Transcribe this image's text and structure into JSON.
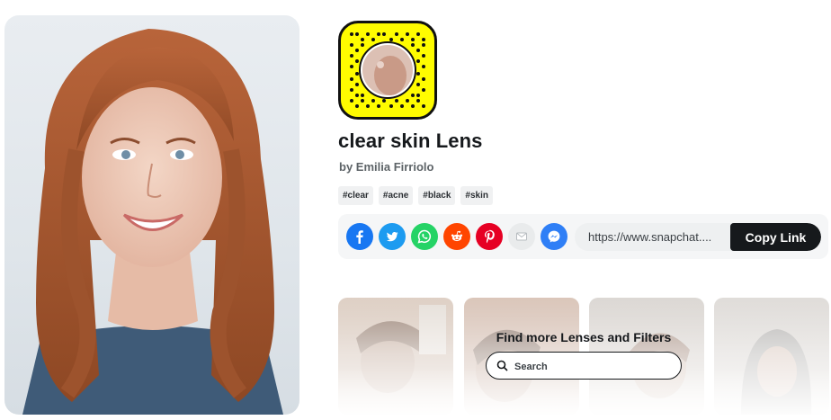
{
  "lens": {
    "title": "clear skin Lens",
    "author": "by Emilia Firriolo",
    "tags": [
      "#clear",
      "#acne",
      "#black",
      "#skin"
    ]
  },
  "snapcode": {
    "accent_color": "#fffc00"
  },
  "share": {
    "buttons": [
      {
        "name": "facebook-icon",
        "color": "#1877f2"
      },
      {
        "name": "twitter-icon",
        "color": "#1d9bf0"
      },
      {
        "name": "whatsapp-icon",
        "color": "#25d366"
      },
      {
        "name": "reddit-icon",
        "color": "#ff4500"
      },
      {
        "name": "pinterest-icon",
        "color": "#e60023"
      },
      {
        "name": "email-icon",
        "color": "#e9ebec"
      },
      {
        "name": "messenger-icon",
        "color": "#2f7ff6"
      }
    ],
    "link_text": "https://www.snapchat....",
    "copy_label": "Copy Link"
  },
  "more": {
    "heading": "Find more Lenses and Filters",
    "search_placeholder": "Search"
  }
}
